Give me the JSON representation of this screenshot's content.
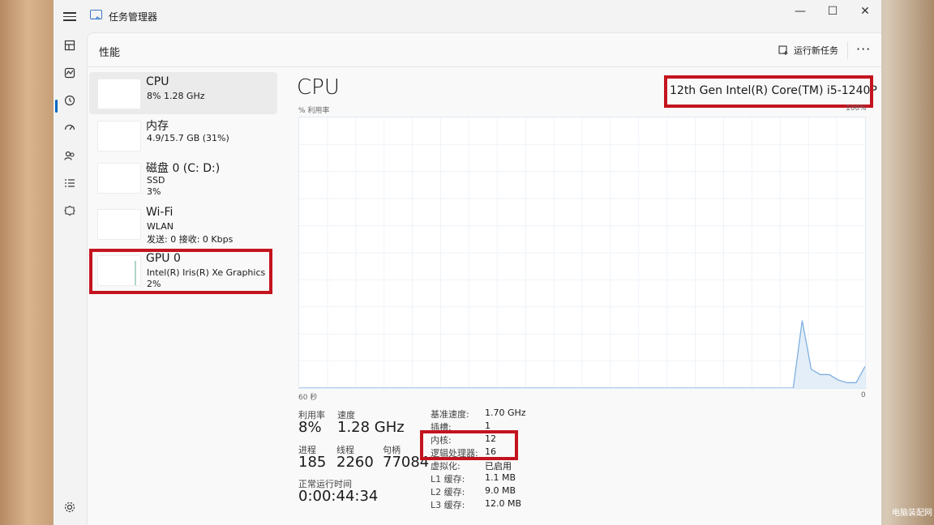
{
  "app": {
    "title": "任务管理器"
  },
  "window_controls": {
    "minimize": "—",
    "maximize": "☐",
    "close": "✕"
  },
  "nav_icons": [
    "processes-icon",
    "performance-icon",
    "app-history-icon",
    "startup-apps-icon",
    "users-icon",
    "details-icon",
    "services-icon"
  ],
  "header": {
    "title": "性能",
    "run_new_task": "运行新任务",
    "more": "···"
  },
  "sidebar_items": [
    {
      "title": "CPU",
      "line1": "8% 1.28 GHz",
      "line2": ""
    },
    {
      "title": "内存",
      "line1": "4.9/15.7 GB (31%)",
      "line2": ""
    },
    {
      "title": "磁盘 0 (C: D:)",
      "line1": "SSD",
      "line2": "3%"
    },
    {
      "title": "Wi-Fi",
      "line1": "WLAN",
      "line2": "发送: 0 接收: 0 Kbps"
    },
    {
      "title": "GPU 0",
      "line1": "Intel(R) Iris(R) Xe Graphics",
      "line2": "2%"
    }
  ],
  "main": {
    "title": "CPU",
    "model": "12th Gen Intel(R) Core(TM) i5-1240P",
    "graph_label": "% 利用率",
    "graph_max": "100%",
    "graph_left": "60 秒",
    "graph_right": "0"
  },
  "chart_data": {
    "type": "area",
    "x": [
      0,
      1,
      2,
      3,
      4,
      5,
      6,
      7,
      8,
      9,
      10,
      11,
      12,
      13,
      14,
      15,
      16,
      17,
      18,
      19,
      20,
      21,
      22,
      23,
      24,
      25,
      26,
      27,
      28,
      29,
      30,
      31,
      32,
      33,
      34,
      35,
      36,
      37,
      38,
      39,
      40,
      41,
      42,
      43,
      44,
      45,
      46,
      47,
      48,
      49,
      50,
      51,
      52,
      53,
      54,
      55,
      56,
      57,
      58,
      59,
      60
    ],
    "values": [
      0,
      0,
      0,
      0,
      0,
      0,
      0,
      0,
      0,
      0,
      0,
      0,
      0,
      0,
      0,
      0,
      0,
      0,
      0,
      0,
      0,
      0,
      0,
      0,
      0,
      0,
      0,
      0,
      0,
      0,
      0,
      0,
      0,
      0,
      0,
      0,
      0,
      0,
      0,
      0,
      0,
      0,
      0,
      0,
      0,
      0,
      0,
      0,
      0,
      0,
      0,
      0,
      0,
      0,
      0,
      0,
      25,
      7,
      5,
      5,
      3,
      2,
      2,
      8
    ],
    "ylim": [
      0,
      100
    ],
    "grid": true
  },
  "stats": {
    "utilization_label": "利用率",
    "utilization": "8%",
    "speed_label": "速度",
    "speed": "1.28 GHz",
    "processes_label": "进程",
    "processes": "185",
    "threads_label": "线程",
    "threads": "2260",
    "handles_label": "句柄",
    "handles": "77084",
    "uptime_label": "正常运行时间",
    "uptime": "0:00:44:34"
  },
  "specs": [
    {
      "label": "基准速度:",
      "value": "1.70 GHz"
    },
    {
      "label": "插槽:",
      "value": "1"
    },
    {
      "label": "内核:",
      "value": "12"
    },
    {
      "label": "逻辑处理器:",
      "value": "16"
    },
    {
      "label": "虚拟化:",
      "value": "已启用"
    },
    {
      "label": "L1 缓存:",
      "value": "1.1 MB"
    },
    {
      "label": "L2 缓存:",
      "value": "9.0 MB"
    },
    {
      "label": "L3 缓存:",
      "value": "12.0 MB"
    }
  ],
  "colors": {
    "accent": "#0067c0",
    "highlight_box": "#c3141e",
    "graph_line": "#7fb0e0",
    "graph_fill": "#e3eef8"
  },
  "watermark": "电脑装配网"
}
